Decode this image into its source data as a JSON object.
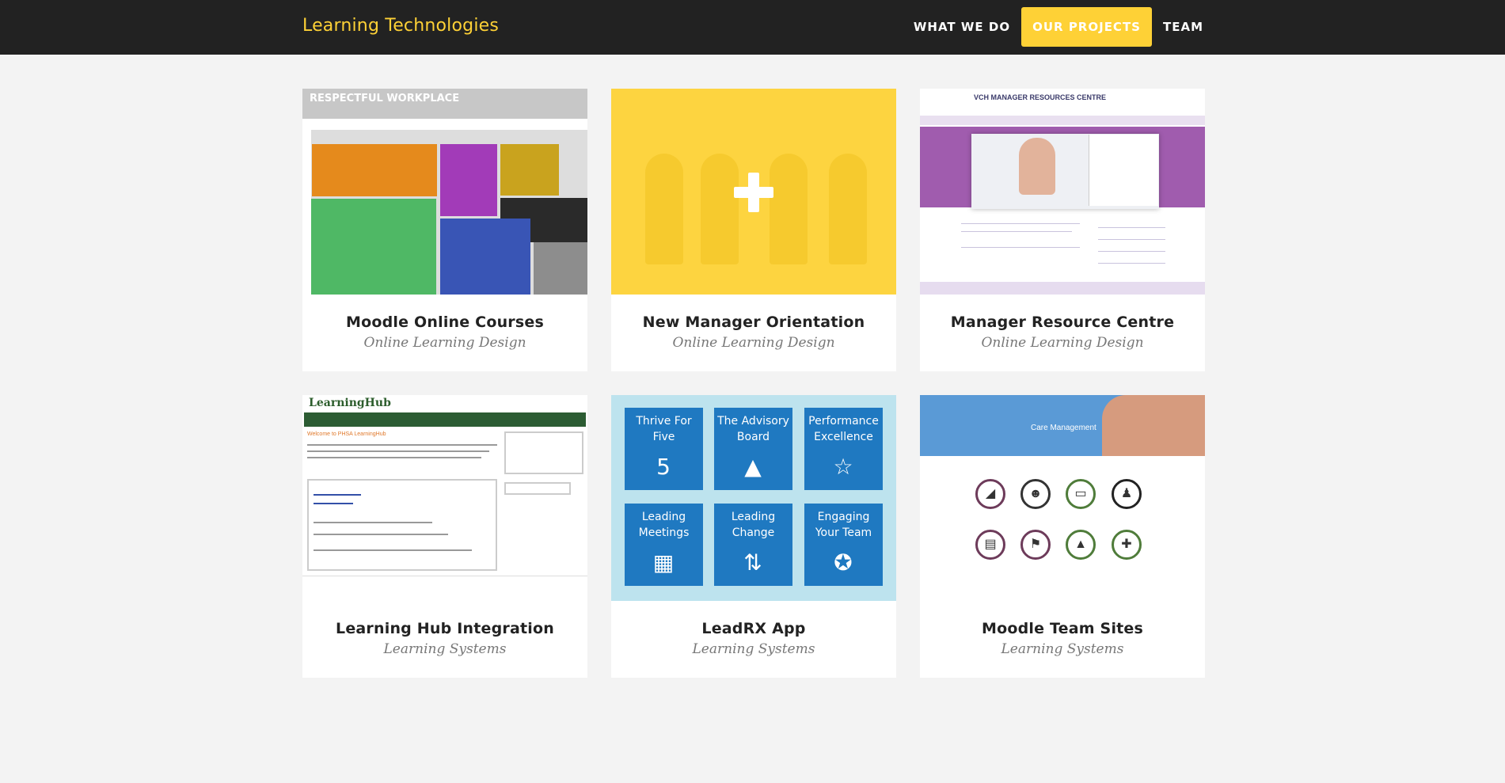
{
  "brand": "Learning Technologies",
  "nav": {
    "items": [
      "WHAT WE DO",
      "OUR PROJECTS",
      "TEAM"
    ]
  },
  "colors": {
    "brand": "#fed136",
    "navbar_bg": "#222222",
    "page_bg": "#f3f3f3"
  },
  "projects": [
    {
      "title": "Moodle Online Courses",
      "category": "Online Learning Design",
      "thumb_text": "RESPECTFUL WORKPLACE"
    },
    {
      "title": "New Manager Orientation",
      "category": "Online Learning Design"
    },
    {
      "title": "Manager Resource Centre",
      "category": "Online Learning Design",
      "thumb_text": "VCH MANAGER RESOURCES CENTRE"
    },
    {
      "title": "Learning Hub Integration",
      "category": "Learning Systems",
      "thumb_text": "LearningHub",
      "thumb_welcome": "Welcome to PHSA LearningHub"
    },
    {
      "title": "LeadRX App",
      "category": "Learning Systems",
      "tiles": [
        "Thrive For Five",
        "The Advisory Board",
        "Performance Excellence",
        "Leading Meetings",
        "Leading Change",
        "Engaging Your Team"
      ],
      "tile_icons": [
        "5",
        "▲",
        "☆",
        "▦",
        "⇅",
        "✪"
      ]
    },
    {
      "title": "Moodle Team Sites",
      "category": "Learning Systems",
      "thumb_text": "Care Management"
    }
  ]
}
